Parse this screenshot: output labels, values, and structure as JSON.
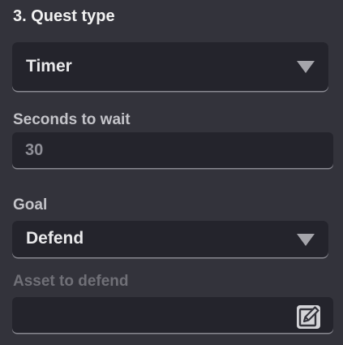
{
  "section": {
    "title": "3. Quest type"
  },
  "quest_type_select": {
    "value": "Timer"
  },
  "seconds_field": {
    "label": "Seconds to wait",
    "value": "30"
  },
  "goal_field": {
    "label": "Goal",
    "value": "Defend"
  },
  "asset_field": {
    "label": "Asset to defend",
    "value": ""
  },
  "icons": {
    "dropdown_arrow": "triangle-down-icon",
    "edit": "edit-icon"
  },
  "colors": {
    "background": "#33333b",
    "field_background": "#24242c",
    "title_text": "#f2f2f2",
    "label_text": "#c4c4c9",
    "muted_label_text": "#707077",
    "field_underline": "#888890"
  }
}
